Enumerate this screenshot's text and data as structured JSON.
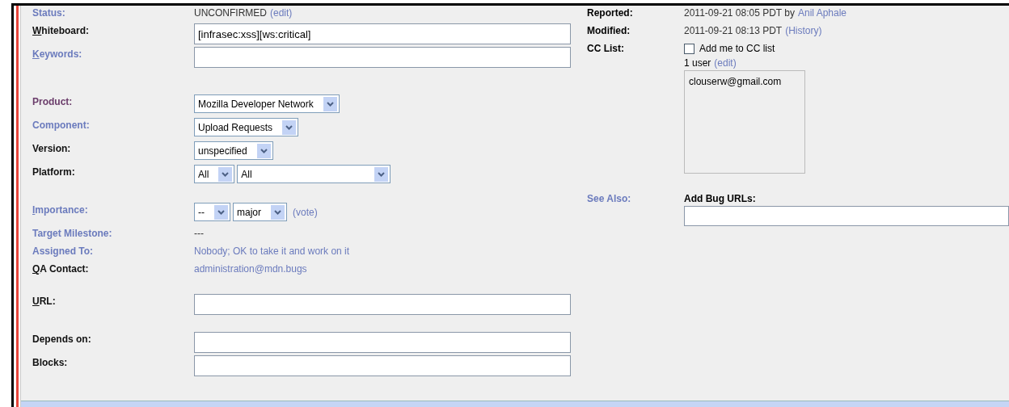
{
  "left_sections": [
    [
      {
        "kind": "text",
        "label": "Status:",
        "color": "#6b7bbd",
        "value": "UNCONFIRMED",
        "link": "(edit)"
      },
      {
        "kind": "input",
        "label": "Whiteboard:",
        "color": "#111111",
        "underline_first": true,
        "value": "[infrasec:xss][ws:critical]"
      },
      {
        "kind": "input",
        "label": "Keywords:",
        "color": "#6b7bbd",
        "underline_first": true
      }
    ],
    [
      {
        "kind": "select",
        "label": "Product:",
        "color": "#6b3d6b",
        "selects": [
          "Mozilla Developer Network"
        ]
      },
      {
        "kind": "select",
        "label": "Component:",
        "color": "#6b7bbd",
        "selects": [
          "Upload Requests"
        ]
      },
      {
        "kind": "select",
        "label": "Version:",
        "color": "#111111",
        "selects": [
          "unspecified"
        ]
      },
      {
        "kind": "select",
        "label": "Platform:",
        "color": "#111111",
        "selects": [
          "All",
          "All"
        ]
      }
    ],
    [
      {
        "kind": "select",
        "label": "Importance:",
        "color": "#6b7bbd",
        "underline_first": true,
        "selects": [
          "--",
          "major"
        ],
        "link": "(vote)"
      },
      {
        "kind": "text",
        "label": "Target Milestone:",
        "color": "#6b7bbd",
        "value": "---"
      },
      {
        "kind": "link",
        "label": "Assigned To:",
        "color": "#6b7bbd",
        "value": "Nobody; OK to take it and work on it"
      },
      {
        "kind": "link",
        "label": "QA Contact:",
        "color": "#111111",
        "underline_first": true,
        "value": "administration@mdn.bugs"
      }
    ],
    [
      {
        "kind": "input",
        "label": "URL:",
        "color": "#111111",
        "underline_first": true
      }
    ],
    [
      {
        "kind": "input",
        "label": "Depends on:",
        "color": "#111111"
      },
      {
        "kind": "input",
        "label": "Blocks:",
        "color": "#111111"
      }
    ]
  ],
  "reported": {
    "label": "Reported:",
    "value": "2011-09-21 08:05 PDT by",
    "link": "Anil Aphale"
  },
  "modified": {
    "label": "Modified:",
    "value": "2011-09-21 08:13 PDT",
    "link": "(History)"
  },
  "cc_list": {
    "label": "CC List:",
    "checkbox": {
      "label": "Add me to CC list",
      "checked": false
    },
    "count": "1 user",
    "link": "(edit)",
    "users": [
      "clouserw@gmail.com"
    ]
  },
  "see_also": {
    "label": "See Also:",
    "heading": "Add Bug URLs:"
  }
}
